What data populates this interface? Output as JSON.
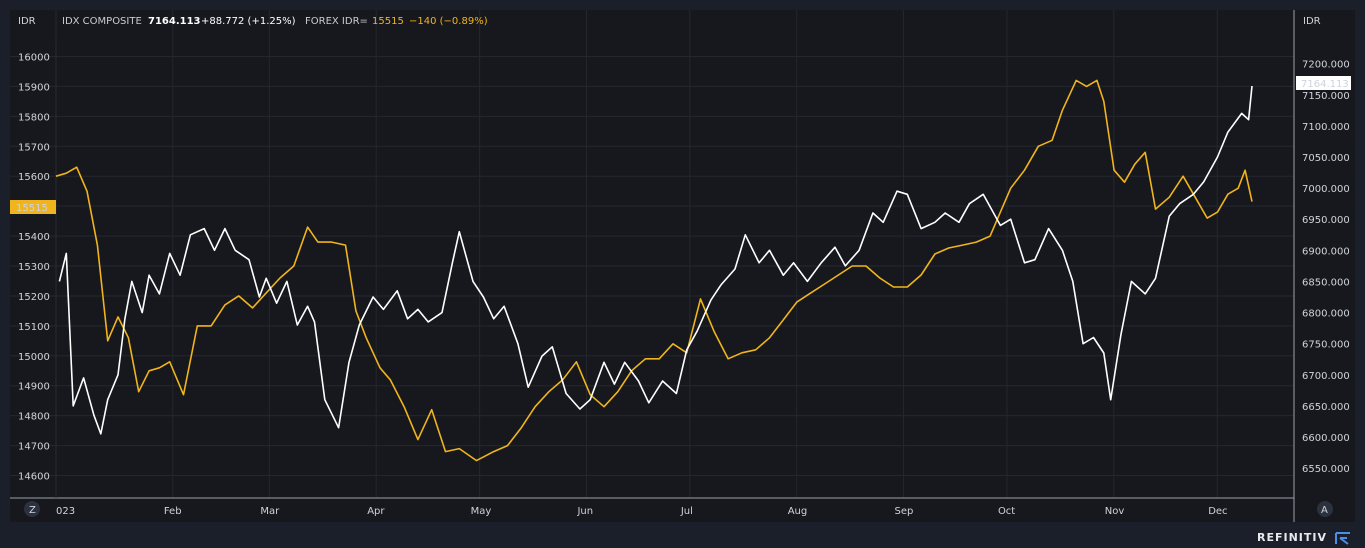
{
  "header": {
    "left_unit": "IDR",
    "right_unit": "IDR",
    "idx_name": "IDX COMPOSITE",
    "idx_value": "7164.113",
    "idx_change": "+88.772 (+1.25%)",
    "fx_name": "FOREX IDR=",
    "fx_value": "15515",
    "fx_change": "−140 (−0.89%)"
  },
  "tags": {
    "left_price": "15515",
    "right_price": "7164.113"
  },
  "buttons": {
    "zoom_left": "Z",
    "auto_right": "A"
  },
  "brand": "REFINITIV",
  "colors": {
    "background": "#16181d",
    "frame": "#1b1f2a",
    "idx_line": "#ffffff",
    "fx_line": "#f0b41c",
    "grid": "#2a2d33"
  },
  "chart_data": {
    "type": "line",
    "x_ticks": [
      "023",
      "Feb",
      "Mar",
      "Apr",
      "May",
      "Jun",
      "Jul",
      "Aug",
      "Sep",
      "Oct",
      "Nov",
      "Dec"
    ],
    "x_range": [
      "2023-01-01",
      "2023-12-14"
    ],
    "left_axis": {
      "unit": "IDR",
      "ticks": [
        "16000",
        "15900",
        "15800",
        "15700",
        "15600",
        "15500",
        "15400",
        "15300",
        "15200",
        "15100",
        "15000",
        "14900",
        "14800",
        "14700",
        "14600"
      ],
      "range": [
        14525,
        16055
      ]
    },
    "right_axis": {
      "unit": "IDR",
      "ticks": [
        "7200.000",
        "7150.000",
        "7100.000",
        "7050.000",
        "7000.000",
        "6950.000",
        "6900.000",
        "6850.000",
        "6800.000",
        "6750.000",
        "6700.000",
        "6650.000",
        "6600.000",
        "6550.000"
      ],
      "range": [
        6502,
        7238
      ]
    },
    "series": [
      {
        "name": "IDX COMPOSITE",
        "axis": "right",
        "color": "#ffffff",
        "points": [
          [
            "2023-01-02",
            6850
          ],
          [
            "2023-01-04",
            6895
          ],
          [
            "2023-01-06",
            6650
          ],
          [
            "2023-01-09",
            6695
          ],
          [
            "2023-01-12",
            6635
          ],
          [
            "2023-01-14",
            6605
          ],
          [
            "2023-01-16",
            6660
          ],
          [
            "2023-01-19",
            6700
          ],
          [
            "2023-01-21",
            6790
          ],
          [
            "2023-01-23",
            6850
          ],
          [
            "2023-01-26",
            6800
          ],
          [
            "2023-01-28",
            6860
          ],
          [
            "2023-01-31",
            6830
          ],
          [
            "2023-02-03",
            6895
          ],
          [
            "2023-02-06",
            6860
          ],
          [
            "2023-02-09",
            6925
          ],
          [
            "2023-02-13",
            6935
          ],
          [
            "2023-02-16",
            6900
          ],
          [
            "2023-02-19",
            6935
          ],
          [
            "2023-02-22",
            6900
          ],
          [
            "2023-02-26",
            6885
          ],
          [
            "2023-03-01",
            6825
          ],
          [
            "2023-03-03",
            6855
          ],
          [
            "2023-03-06",
            6815
          ],
          [
            "2023-03-09",
            6850
          ],
          [
            "2023-03-12",
            6780
          ],
          [
            "2023-03-15",
            6810
          ],
          [
            "2023-03-17",
            6785
          ],
          [
            "2023-03-20",
            6660
          ],
          [
            "2023-03-24",
            6615
          ],
          [
            "2023-03-27",
            6720
          ],
          [
            "2023-03-30",
            6780
          ],
          [
            "2023-04-03",
            6825
          ],
          [
            "2023-04-06",
            6805
          ],
          [
            "2023-04-10",
            6835
          ],
          [
            "2023-04-13",
            6790
          ],
          [
            "2023-04-16",
            6805
          ],
          [
            "2023-04-19",
            6785
          ],
          [
            "2023-04-23",
            6800
          ],
          [
            "2023-04-26",
            6880
          ],
          [
            "2023-04-28",
            6930
          ],
          [
            "2023-05-02",
            6850
          ],
          [
            "2023-05-05",
            6825
          ],
          [
            "2023-05-08",
            6790
          ],
          [
            "2023-05-11",
            6810
          ],
          [
            "2023-05-15",
            6750
          ],
          [
            "2023-05-18",
            6680
          ],
          [
            "2023-05-22",
            6730
          ],
          [
            "2023-05-25",
            6745
          ],
          [
            "2023-05-29",
            6670
          ],
          [
            "2023-06-02",
            6645
          ],
          [
            "2023-06-05",
            6660
          ],
          [
            "2023-06-09",
            6720
          ],
          [
            "2023-06-12",
            6685
          ],
          [
            "2023-06-15",
            6720
          ],
          [
            "2023-06-19",
            6690
          ],
          [
            "2023-06-22",
            6655
          ],
          [
            "2023-06-26",
            6690
          ],
          [
            "2023-06-30",
            6670
          ],
          [
            "2023-07-03",
            6740
          ],
          [
            "2023-07-06",
            6770
          ],
          [
            "2023-07-10",
            6820
          ],
          [
            "2023-07-13",
            6845
          ],
          [
            "2023-07-17",
            6870
          ],
          [
            "2023-07-20",
            6925
          ],
          [
            "2023-07-24",
            6880
          ],
          [
            "2023-07-27",
            6900
          ],
          [
            "2023-07-31",
            6860
          ],
          [
            "2023-08-03",
            6880
          ],
          [
            "2023-08-07",
            6850
          ],
          [
            "2023-08-11",
            6880
          ],
          [
            "2023-08-15",
            6905
          ],
          [
            "2023-08-18",
            6875
          ],
          [
            "2023-08-22",
            6900
          ],
          [
            "2023-08-26",
            6960
          ],
          [
            "2023-08-29",
            6945
          ],
          [
            "2023-09-02",
            6995
          ],
          [
            "2023-09-05",
            6990
          ],
          [
            "2023-09-09",
            6935
          ],
          [
            "2023-09-13",
            6945
          ],
          [
            "2023-09-16",
            6960
          ],
          [
            "2023-09-20",
            6945
          ],
          [
            "2023-09-23",
            6975
          ],
          [
            "2023-09-27",
            6990
          ],
          [
            "2023-10-02",
            6940
          ],
          [
            "2023-10-05",
            6950
          ],
          [
            "2023-10-09",
            6880
          ],
          [
            "2023-10-12",
            6885
          ],
          [
            "2023-10-16",
            6935
          ],
          [
            "2023-10-20",
            6900
          ],
          [
            "2023-10-23",
            6850
          ],
          [
            "2023-10-26",
            6750
          ],
          [
            "2023-10-29",
            6760
          ],
          [
            "2023-11-01",
            6735
          ],
          [
            "2023-11-03",
            6660
          ],
          [
            "2023-11-06",
            6765
          ],
          [
            "2023-11-09",
            6850
          ],
          [
            "2023-11-13",
            6830
          ],
          [
            "2023-11-16",
            6855
          ],
          [
            "2023-11-20",
            6955
          ],
          [
            "2023-11-23",
            6975
          ],
          [
            "2023-11-27",
            6990
          ],
          [
            "2023-11-30",
            7010
          ],
          [
            "2023-12-04",
            7050
          ],
          [
            "2023-12-07",
            7090
          ],
          [
            "2023-12-11",
            7120
          ],
          [
            "2023-12-13",
            7110
          ],
          [
            "2023-12-14",
            7164
          ]
        ]
      },
      {
        "name": "FOREX IDR=",
        "axis": "left",
        "color": "#f0b41c",
        "points": [
          [
            "2023-01-01",
            15600
          ],
          [
            "2023-01-04",
            15610
          ],
          [
            "2023-01-07",
            15630
          ],
          [
            "2023-01-10",
            15550
          ],
          [
            "2023-01-13",
            15370
          ],
          [
            "2023-01-16",
            15050
          ],
          [
            "2023-01-19",
            15130
          ],
          [
            "2023-01-22",
            15060
          ],
          [
            "2023-01-25",
            14880
          ],
          [
            "2023-01-28",
            14950
          ],
          [
            "2023-01-31",
            14960
          ],
          [
            "2023-02-03",
            14980
          ],
          [
            "2023-02-07",
            14870
          ],
          [
            "2023-02-11",
            15100
          ],
          [
            "2023-02-15",
            15100
          ],
          [
            "2023-02-19",
            15170
          ],
          [
            "2023-02-23",
            15200
          ],
          [
            "2023-02-27",
            15160
          ],
          [
            "2023-03-03",
            15210
          ],
          [
            "2023-03-07",
            15260
          ],
          [
            "2023-03-11",
            15300
          ],
          [
            "2023-03-15",
            15430
          ],
          [
            "2023-03-18",
            15380
          ],
          [
            "2023-03-22",
            15380
          ],
          [
            "2023-03-26",
            15370
          ],
          [
            "2023-03-29",
            15150
          ],
          [
            "2023-04-01",
            15060
          ],
          [
            "2023-04-05",
            14960
          ],
          [
            "2023-04-08",
            14920
          ],
          [
            "2023-04-12",
            14830
          ],
          [
            "2023-04-16",
            14720
          ],
          [
            "2023-04-20",
            14820
          ],
          [
            "2023-04-24",
            14680
          ],
          [
            "2023-04-28",
            14690
          ],
          [
            "2023-05-03",
            14650
          ],
          [
            "2023-05-08",
            14680
          ],
          [
            "2023-05-12",
            14700
          ],
          [
            "2023-05-16",
            14760
          ],
          [
            "2023-05-20",
            14830
          ],
          [
            "2023-05-24",
            14880
          ],
          [
            "2023-05-28",
            14920
          ],
          [
            "2023-06-01",
            14980
          ],
          [
            "2023-06-05",
            14870
          ],
          [
            "2023-06-09",
            14830
          ],
          [
            "2023-06-13",
            14880
          ],
          [
            "2023-06-17",
            14950
          ],
          [
            "2023-06-21",
            14990
          ],
          [
            "2023-06-25",
            14990
          ],
          [
            "2023-06-29",
            15040
          ],
          [
            "2023-07-03",
            15010
          ],
          [
            "2023-07-07",
            15190
          ],
          [
            "2023-07-11",
            15080
          ],
          [
            "2023-07-15",
            14990
          ],
          [
            "2023-07-19",
            15010
          ],
          [
            "2023-07-23",
            15020
          ],
          [
            "2023-07-27",
            15060
          ],
          [
            "2023-07-31",
            15120
          ],
          [
            "2023-08-04",
            15180
          ],
          [
            "2023-08-08",
            15210
          ],
          [
            "2023-08-12",
            15240
          ],
          [
            "2023-08-16,",
            15270
          ],
          [
            "2023-08-20",
            15300
          ],
          [
            "2023-08-24",
            15300
          ],
          [
            "2023-08-28",
            15260
          ],
          [
            "2023-09-01",
            15230
          ],
          [
            "2023-09-05",
            15230
          ],
          [
            "2023-09-09",
            15270
          ],
          [
            "2023-09-13",
            15340
          ],
          [
            "2023-09-17",
            15360
          ],
          [
            "2023-09-21",
            15370
          ],
          [
            "2023-09-25",
            15380
          ],
          [
            "2023-09-29",
            15400
          ],
          [
            "2023-10-02",
            15480
          ],
          [
            "2023-10-05",
            15560
          ],
          [
            "2023-10-09",
            15620
          ],
          [
            "2023-10-13",
            15700
          ],
          [
            "2023-10-17",
            15720
          ],
          [
            "2023-10-20",
            15820
          ],
          [
            "2023-10-24",
            15920
          ],
          [
            "2023-10-27",
            15900
          ],
          [
            "2023-10-30",
            15920
          ],
          [
            "2023-11-01",
            15850
          ],
          [
            "2023-11-04",
            15620
          ],
          [
            "2023-11-07",
            15580
          ],
          [
            "2023-11-10",
            15640
          ],
          [
            "2023-11-13",
            15680
          ],
          [
            "2023-11-16",
            15490
          ],
          [
            "2023-11-20",
            15530
          ],
          [
            "2023-11-24",
            15600
          ],
          [
            "2023-11-28",
            15520
          ],
          [
            "2023-12-01",
            15460
          ],
          [
            "2023-12-04",
            15480
          ],
          [
            "2023-12-07",
            15540
          ],
          [
            "2023-12-10",
            15560
          ],
          [
            "2023-12-12",
            15620
          ],
          [
            "2023-12-14",
            15515
          ]
        ]
      }
    ]
  }
}
